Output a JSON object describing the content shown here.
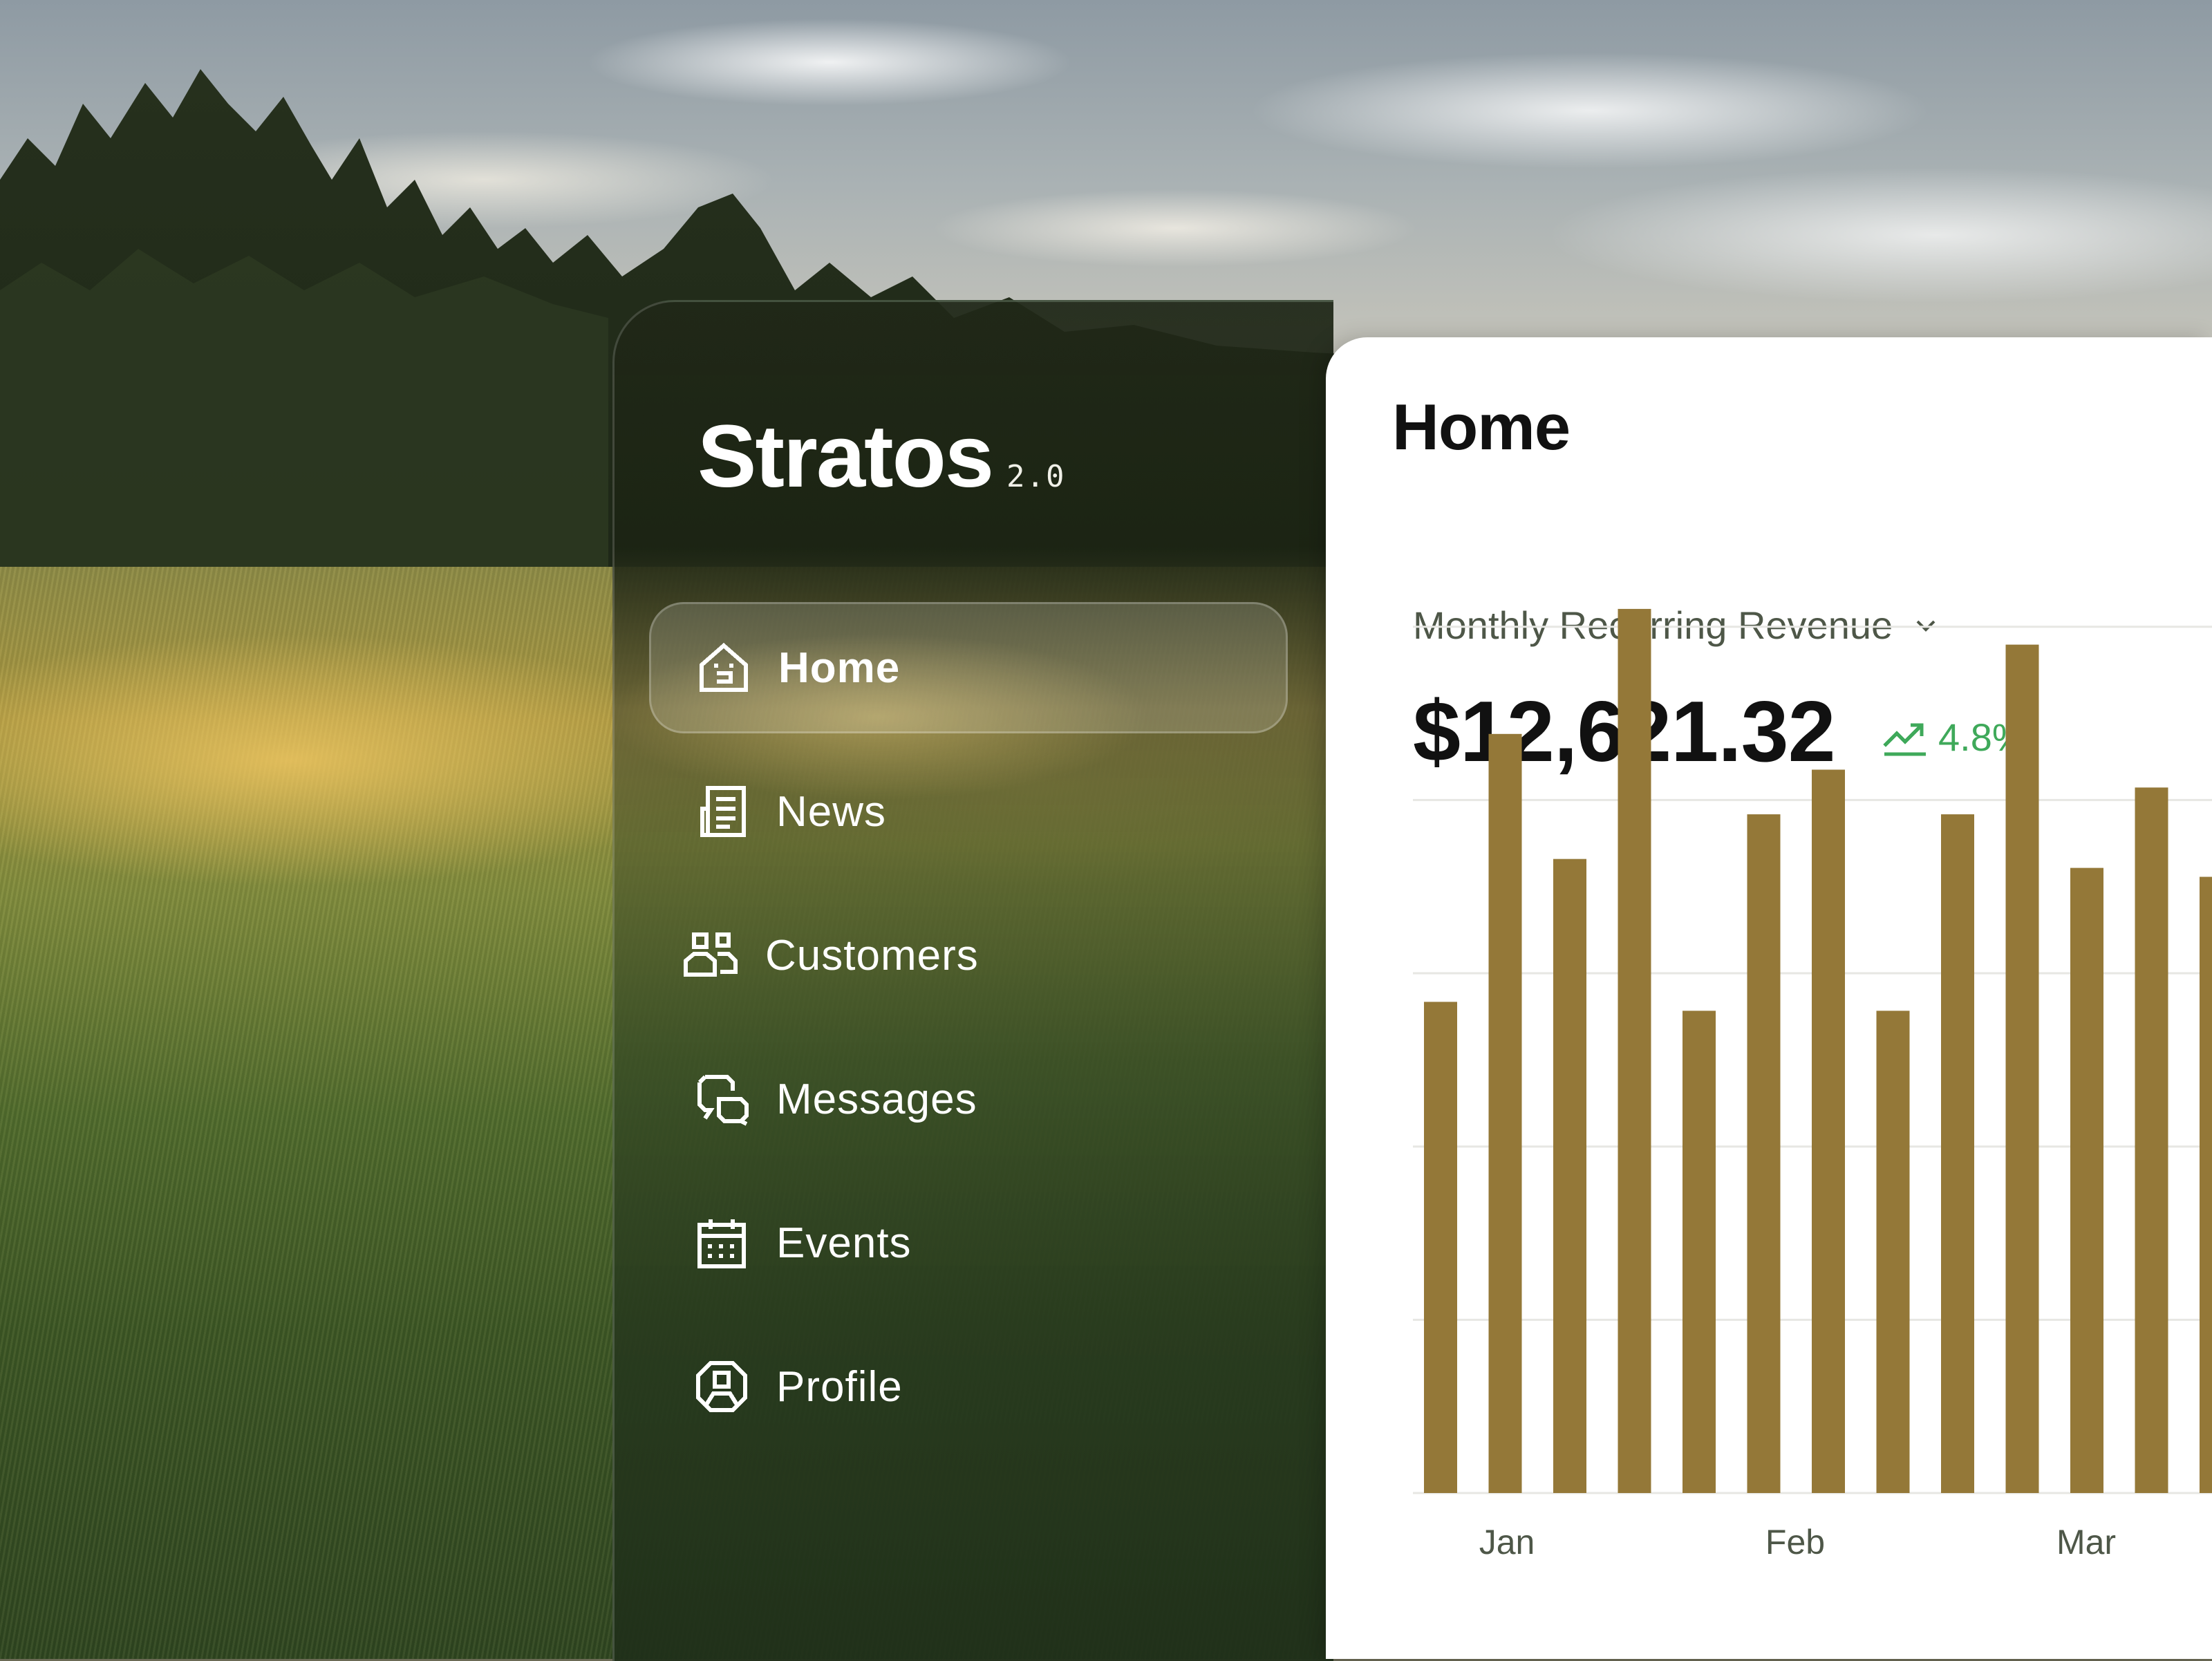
{
  "app": {
    "name": "Stratos",
    "version": "2.0"
  },
  "sidebar": {
    "items": [
      {
        "label": "Home",
        "icon": "home-icon",
        "active": true
      },
      {
        "label": "News",
        "icon": "newspaper-icon",
        "active": false
      },
      {
        "label": "Customers",
        "icon": "users-icon",
        "active": false
      },
      {
        "label": "Messages",
        "icon": "chat-bubbles-icon",
        "active": false
      },
      {
        "label": "Events",
        "icon": "calendar-icon",
        "active": false
      },
      {
        "label": "Profile",
        "icon": "user-circle-icon",
        "active": false
      }
    ]
  },
  "main": {
    "title": "Home",
    "metric": {
      "label": "Monthly Recurring Revenue",
      "value": "$12,621.32",
      "change": "4.8%",
      "change_icon": "trending-up-icon",
      "dropdown_icon": "chevron-down-icon"
    }
  },
  "colors": {
    "bar": "#947838",
    "positive": "#3fa95a",
    "grid": "#e7e7e3"
  },
  "chart_data": {
    "type": "bar",
    "x_tick_labels": [
      "Jan",
      "Feb",
      "Mar"
    ],
    "values": [
      55,
      85,
      71,
      99,
      54,
      76,
      81,
      54,
      76,
      95,
      70,
      79,
      69
    ],
    "ylim": [
      0,
      100
    ],
    "grid": true,
    "title": "",
    "xlabel": "",
    "ylabel": ""
  }
}
